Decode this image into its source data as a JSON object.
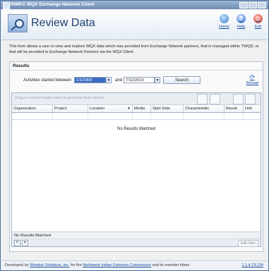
{
  "window": {
    "title": "RWIFC WQX Exchange Network Client"
  },
  "header": {
    "title": "Review Data",
    "nav": [
      {
        "label": "Home",
        "icon": "home-icon",
        "color": "#3f7fc4"
      },
      {
        "label": "Help",
        "icon": "help-icon",
        "color": "#2f6ccf"
      },
      {
        "label": "Exit",
        "icon": "exit-icon",
        "color": "#c0392b"
      }
    ]
  },
  "description": "This form allows a user to view and explore WQX data which was provided from Exchange Network partners, that is managed within TWQD, or that will be provided to Exchange Network Partners via the WQX Client.",
  "results": {
    "heading": "Results",
    "activities_label": "Activities started between",
    "start_date": "1/1/1900",
    "and_label": "and",
    "end_date": "7/12/2010",
    "search_label": "Search",
    "reload_label": "Reload",
    "group_hint": "Drag a column header here to group by that column",
    "columns": [
      "Organization",
      "Project",
      "Location",
      "Media",
      "Start Date",
      "Characteristic",
      "Result",
      "Unit"
    ],
    "no_results": "No Results Matched",
    "status": "No Results Matched",
    "edit_filter": "Edit Filter"
  },
  "footer": {
    "developed_by": "Developed by",
    "company": "Windsor Solutions, Inc.",
    "for_the": "for the",
    "commission": "Northwest Indian Fisheries Commission",
    "members": "and its member tribes",
    "version": "1.1.4.79.134"
  }
}
